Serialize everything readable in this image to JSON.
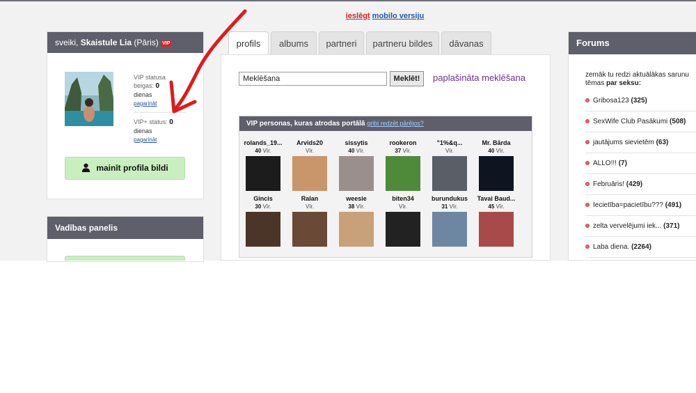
{
  "mobile": {
    "enable": "ieslēgt",
    "version": "mobilo versiju"
  },
  "user_panel": {
    "greeting": "sveiki,",
    "username": "Skaistule Lia",
    "suffix": "(Pāris)",
    "vip_badge": "VIP",
    "vip_end_label_1": "VIP statusa",
    "vip_end_label_2": "beigas:",
    "vip_end_value": "0",
    "days": "dienas",
    "extend": "pagarināt",
    "vip_plus_label": "VIP+ status:",
    "vip_plus_value": "0",
    "change_photo": "mainīt profila bildi"
  },
  "control_panel": {
    "title": "Vadības panelis"
  },
  "tabs": [
    {
      "label": "profils",
      "active": true
    },
    {
      "label": "albums"
    },
    {
      "label": "partneri"
    },
    {
      "label": "partneru bildes"
    },
    {
      "label": "dāvanas"
    }
  ],
  "search": {
    "value": "Meklēšana",
    "button": "Meklēt!",
    "advanced": "paplašināta meklēšana"
  },
  "vip_box": {
    "title": "VIP personas, kuras atrodas portālā",
    "see_others": "gribi redzēt pārējos?",
    "persons": [
      {
        "name": "rolands_19...",
        "age": "40",
        "unit": "Vīr.",
        "color": "#1c1c1c"
      },
      {
        "name": "Arvids20",
        "age": "",
        "unit": "Vīr.",
        "color": "#c9956a"
      },
      {
        "name": "sissytis",
        "age": "40",
        "unit": "Vīr.",
        "color": "#9a8f8c"
      },
      {
        "name": "rookeron",
        "age": "37",
        "unit": "Vīr.",
        "color": "#4f8a3a"
      },
      {
        "name": "\"1%&q...",
        "age": "",
        "unit": "Vīr.",
        "color": "#5a5e66"
      },
      {
        "name": "Mr. Bārda",
        "age": "40",
        "unit": "Vīr.",
        "color": "#0e1520"
      },
      {
        "name": "Gincis",
        "age": "30",
        "unit": "Vīr.",
        "color": "#4a3528"
      },
      {
        "name": "Ralan",
        "age": "",
        "unit": "Vīr.",
        "color": "#6a4a36"
      },
      {
        "name": "weesie",
        "age": "38",
        "unit": "Vīr.",
        "color": "#c8a079"
      },
      {
        "name": "biten34",
        "age": "",
        "unit": "Vīr.",
        "color": "#222222"
      },
      {
        "name": "burundukus",
        "age": "31",
        "unit": "Vīr.",
        "color": "#6d87a3"
      },
      {
        "name": "Tavai Baud...",
        "age": "45",
        "unit": "Vīr.",
        "color": "#a84a4a"
      }
    ]
  },
  "forum": {
    "title": "Forums",
    "intro": "zemāk tu redzi aktuālākas sarunu tēmas",
    "intro_bold": "par seksu:",
    "items": [
      {
        "title": "Gribosa123",
        "count": "(325)"
      },
      {
        "title": "SexWife Club Pasākumi",
        "count": "(508)"
      },
      {
        "title": "jautājums sievietēm",
        "count": "(63)"
      },
      {
        "title": "ALLO!!!",
        "count": "(7)"
      },
      {
        "title": "Februāris!",
        "count": "(429)"
      },
      {
        "title": "Iecietība=pacietību???",
        "count": "(491)"
      },
      {
        "title": "zelta vervelējumi iek...",
        "count": "(371)"
      },
      {
        "title": "Laba diena.",
        "count": "(2264)"
      }
    ]
  }
}
